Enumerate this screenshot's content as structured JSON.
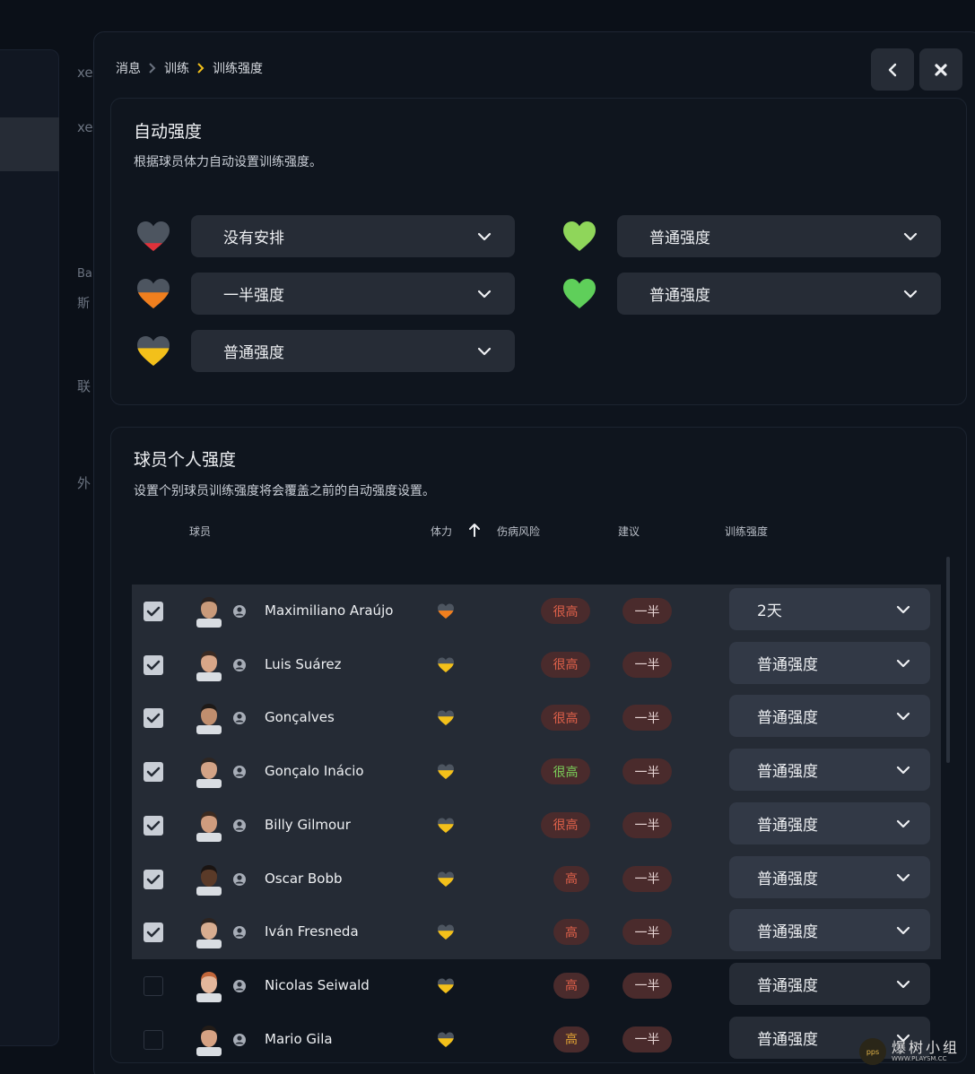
{
  "background": {
    "fragments": [
      "xe",
      "xe",
      "Ba",
      "斯",
      "联",
      "外"
    ]
  },
  "breadcrumb": {
    "items": [
      "消息",
      "训练",
      "训练强度"
    ]
  },
  "header": {
    "back_icon": "chevron-left-icon",
    "close_icon": "close-icon"
  },
  "auto": {
    "title": "自动强度",
    "subtitle": "根据球员体力自动设置训练强度。",
    "options": [
      {
        "level": "red",
        "value": "没有安排"
      },
      {
        "level": "orange",
        "value": "一半强度"
      },
      {
        "level": "yellow",
        "value": "普通强度"
      },
      {
        "level": "lightgreen",
        "value": "普通强度"
      },
      {
        "level": "green",
        "value": "普通强度"
      }
    ]
  },
  "individual": {
    "title": "球员个人强度",
    "subtitle": "设置个别球员训练强度将会覆盖之前的自动强度设置。",
    "columns": {
      "player": "球员",
      "stamina": "体力",
      "injury": "伤病风险",
      "suggest": "建议",
      "intensity": "训练强度"
    },
    "rows": [
      {
        "checked": true,
        "name": "Maximiliano Araújo",
        "stamina": "orange",
        "risk": "很高",
        "risk_color": "#e0614a",
        "suggest": "一半",
        "intensity": "2天"
      },
      {
        "checked": true,
        "name": "Luis Suárez",
        "stamina": "yellow",
        "risk": "很高",
        "risk_color": "#e0614a",
        "suggest": "一半",
        "intensity": "普通强度"
      },
      {
        "checked": true,
        "name": "Gonçalves",
        "stamina": "yellow",
        "risk": "很高",
        "risk_color": "#e0614a",
        "suggest": "一半",
        "intensity": "普通强度"
      },
      {
        "checked": true,
        "name": "Gonçalo Inácio",
        "stamina": "yellow",
        "risk": "很高",
        "risk_color": "#7bd05a",
        "suggest": "一半",
        "intensity": "普通强度"
      },
      {
        "checked": true,
        "name": "Billy Gilmour",
        "stamina": "yellow",
        "risk": "很高",
        "risk_color": "#e0614a",
        "suggest": "一半",
        "intensity": "普通强度"
      },
      {
        "checked": true,
        "name": "Oscar Bobb",
        "stamina": "yellow",
        "risk": "高",
        "risk_color": "#e0614a",
        "suggest": "一半",
        "intensity": "普通强度"
      },
      {
        "checked": true,
        "name": "Iván Fresneda",
        "stamina": "yellow",
        "risk": "高",
        "risk_color": "#e0614a",
        "suggest": "一半",
        "intensity": "普通强度"
      },
      {
        "checked": false,
        "name": "Nicolas Seiwald",
        "stamina": "yellow",
        "risk": "高",
        "risk_color": "#e0614a",
        "suggest": "一半",
        "intensity": "普通强度"
      },
      {
        "checked": false,
        "name": "Mario Gila",
        "stamina": "yellow",
        "risk": "高",
        "risk_color": "#e0a234",
        "suggest": "一半",
        "intensity": "普通强度"
      }
    ]
  },
  "watermark": {
    "logo": "pps",
    "text": "爆树小组",
    "url": "WWW.PLAYSM.CC"
  },
  "colors": {
    "red": "#e0323a",
    "orange": "#f07f1e",
    "yellow": "#f3c01a",
    "lightgreen": "#8fd65a",
    "green": "#5fcf5a",
    "heart_top": "#4d5560",
    "accent": "#f3c01a"
  }
}
